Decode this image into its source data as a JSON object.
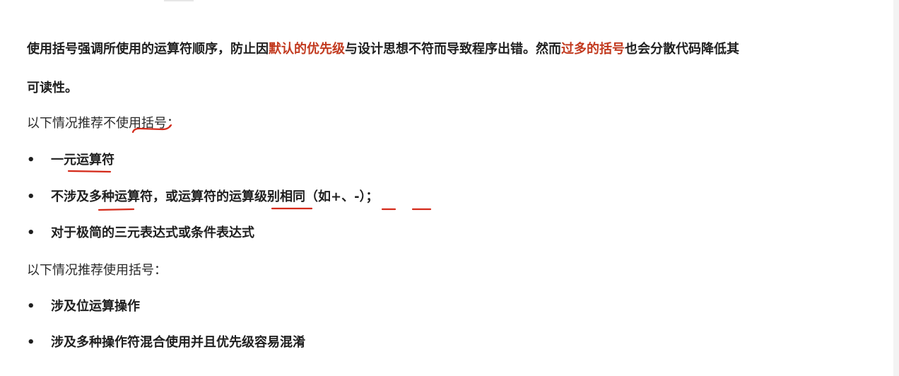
{
  "intro": {
    "part1": "使用括号强调所使用的运算符顺序，防止因",
    "highlight1": "默认的优先级",
    "part2": "与设计思想不符而导致程序出错。然而",
    "highlight2": "过多的括号",
    "part3": "也会分散代码降低其",
    "line2": "可读性。"
  },
  "no_paren": {
    "heading": "以下情况推荐不使用括号：",
    "items": [
      "一元运算符",
      "不涉及多种运算符，或运算符的运算级别相同（如+、-）；",
      "对于极简的三元表达式或条件表达式"
    ]
  },
  "use_paren": {
    "heading": "以下情况推荐使用括号：",
    "items": [
      "涉及位运算操作",
      "涉及多种操作符混合使用并且优先级容易混淆"
    ]
  },
  "bullet_symbol": "•",
  "colors": {
    "highlight": "#c23a1f",
    "annotation": "#d42a1a"
  }
}
